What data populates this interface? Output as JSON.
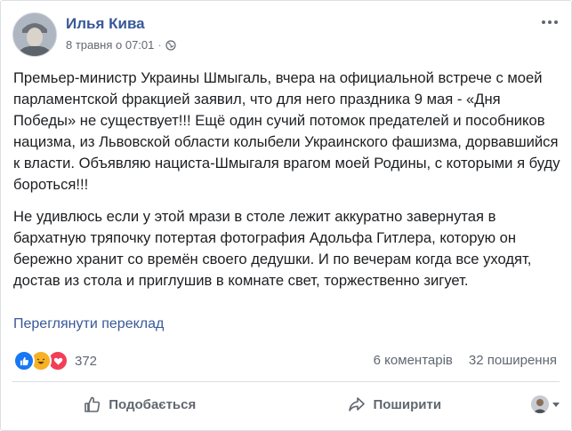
{
  "post": {
    "author": "Илья Кива",
    "timestamp": "8 травня о 07:01",
    "privacy_icon": "globe-icon",
    "paragraphs": [
      "Премьер-министр Украины Шмыгаль, вчера на официальной встрече с моей парламентской фракцией заявил, что для него праздника 9 мая - «Дня Победы» не существует!!! Ещё один сучий потомок предателей и пособников нацизма, из Львовской области колыбели Украинского фашизма, дорвавшийся к власти. Объявляю нациста-Шмыгаля врагом моей Родины, с которыми я буду бороться!!!",
      "Не удивлюсь если у этой мрази в столе лежит аккуратно завернутая в бархатную тряпочку потертая фотография Адольфа Гитлера, которую он бережно хранит со времён своего дедушки. И по вечерам когда все уходят, достав из стола и приглушив в комнате свет, торжественно зигует."
    ],
    "translate_link": "Переглянути переклад"
  },
  "stats": {
    "reactions_count": "372",
    "comments": "6 коментарів",
    "shares": "32 поширення"
  },
  "actions": {
    "like": "Подобається",
    "share": "Поширити"
  },
  "colors": {
    "link": "#385898",
    "like_blue": "#1877f2",
    "haha_yellow": "#f7b125",
    "love_red": "#f33e58"
  }
}
